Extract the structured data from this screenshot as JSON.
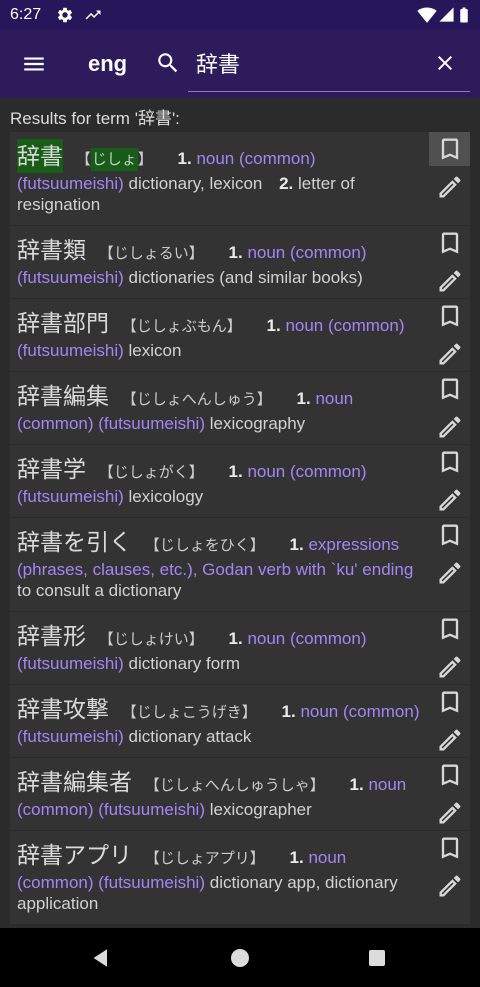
{
  "status_bar": {
    "time": "6:27",
    "left_icons": [
      "gear-icon",
      "trending-up-icon"
    ],
    "right_icons": [
      "wifi-icon",
      "cell-signal-icon",
      "battery-icon"
    ]
  },
  "app_bar": {
    "menu_icon": "menu-icon",
    "language": "eng",
    "search_icon": "search-icon",
    "search_query": "辞書",
    "clear_icon": "close-icon"
  },
  "results_header": "Results for term '辞書':",
  "entry_format": {
    "reading_open": "【",
    "reading_close": "】"
  },
  "entry_actions": {
    "bookmark_icon": "bookmark-border-icon",
    "edit_icon": "edit-icon"
  },
  "results": [
    {
      "headword": "辞書",
      "reading": "じしょ",
      "exact_match": true,
      "bookmark_focused": true,
      "senses": [
        {
          "number": "1.",
          "pos": "noun (common) (futsuumeishi)",
          "gloss": "dictionary, lexicon"
        },
        {
          "number": "2.",
          "pos": "",
          "gloss": "letter of resignation"
        }
      ]
    },
    {
      "headword": "辞書類",
      "reading": "じしょるい",
      "senses": [
        {
          "number": "1.",
          "pos": "noun (common) (futsuumeishi)",
          "gloss": "dictionaries (and similar books)"
        }
      ]
    },
    {
      "headword": "辞書部門",
      "reading": "じしょぶもん",
      "senses": [
        {
          "number": "1.",
          "pos": "noun (common) (futsuumeishi)",
          "gloss": "lexicon"
        }
      ]
    },
    {
      "headword": "辞書編集",
      "reading": "じしょへんしゅう",
      "senses": [
        {
          "number": "1.",
          "pos": "noun (common) (futsuumeishi)",
          "gloss": "lexicography"
        }
      ]
    },
    {
      "headword": "辞書学",
      "reading": "じしょがく",
      "senses": [
        {
          "number": "1.",
          "pos": "noun (common) (futsuumeishi)",
          "gloss": "lexicology"
        }
      ]
    },
    {
      "headword": "辞書を引く",
      "reading": "じしょをひく",
      "senses": [
        {
          "number": "1.",
          "pos": "expressions (phrases, clauses, etc.), Godan verb with `ku' ending",
          "gloss": "to consult a dictionary"
        }
      ]
    },
    {
      "headword": "辞書形",
      "reading": "じしょけい",
      "senses": [
        {
          "number": "1.",
          "pos": "noun (common) (futsuumeishi)",
          "gloss": "dictionary form"
        }
      ]
    },
    {
      "headword": "辞書攻撃",
      "reading": "じしょこうげき",
      "senses": [
        {
          "number": "1.",
          "pos": "noun (common) (futsuumeishi)",
          "gloss": "dictionary attack"
        }
      ]
    },
    {
      "headword": "辞書編集者",
      "reading": "じしょへんしゅうしゃ",
      "senses": [
        {
          "number": "1.",
          "pos": "noun (common) (futsuumeishi)",
          "gloss": "lexicographer"
        }
      ]
    },
    {
      "headword": "辞書アプリ",
      "reading": "じしょアプリ",
      "senses": [
        {
          "number": "1.",
          "pos": "noun (common) (futsuumeishi)",
          "gloss": "dictionary app, dictionary application"
        }
      ]
    }
  ],
  "nav_bar": {
    "back_icon": "back-icon",
    "home_icon": "home-icon",
    "recents_icon": "recents-icon"
  },
  "colors": {
    "status_bar": "#27165a",
    "app_bar": "#2d1b5c",
    "background": "#2b2b2b",
    "card": "#333333",
    "part_of_speech": "#a386f5",
    "match_highlight": "#175c17",
    "focused_action": "#505050"
  }
}
